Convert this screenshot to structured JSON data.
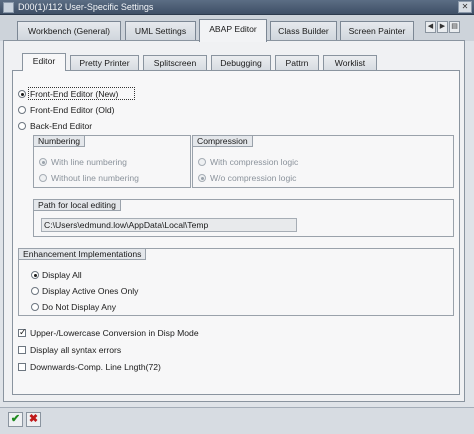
{
  "window": {
    "title": "D00(1)/112 User-Specific Settings"
  },
  "top_tabs": [
    {
      "label": "Workbench (General)"
    },
    {
      "label": "UML Settings"
    },
    {
      "label": "ABAP Editor"
    },
    {
      "label": "Class Builder"
    },
    {
      "label": "Screen Painter"
    }
  ],
  "sub_tabs": [
    {
      "label": "Editor"
    },
    {
      "label": "Pretty Printer"
    },
    {
      "label": "Splitscreen"
    },
    {
      "label": "Debugging"
    },
    {
      "label": "Pattrn"
    },
    {
      "label": "Worklist"
    }
  ],
  "editor_mode": [
    {
      "label": "Front-End Editor (New)",
      "selected": true
    },
    {
      "label": "Front-End Editor (Old)",
      "selected": false
    },
    {
      "label": "Back-End Editor",
      "selected": false
    }
  ],
  "numbering": {
    "title": "Numbering",
    "options": [
      "With line numbering",
      "Without line numbering"
    ]
  },
  "compression": {
    "title": "Compression",
    "options": [
      "With compression logic",
      "W/o compression logic"
    ]
  },
  "local_path": {
    "title": "Path for local editing",
    "value": "C:\\Users\\edmund.low\\AppData\\Local\\Temp"
  },
  "enhancements": {
    "title": "Enhancement Implementations",
    "options": [
      "Display All",
      "Display Active Ones Only",
      "Do Not Display Any"
    ],
    "selected_index": 0
  },
  "checkboxes": [
    {
      "label": "Upper-/Lowercase Conversion in Disp Mode",
      "checked": true
    },
    {
      "label": "Display all syntax errors",
      "checked": false
    },
    {
      "label": "Downwards-Comp. Line Lngth(72)",
      "checked": false
    }
  ],
  "footer": {
    "confirm_symbol": "✔",
    "cancel_symbol": "✖"
  },
  "colors": {
    "confirm": "#1f8a1f",
    "cancel": "#c0191a"
  }
}
